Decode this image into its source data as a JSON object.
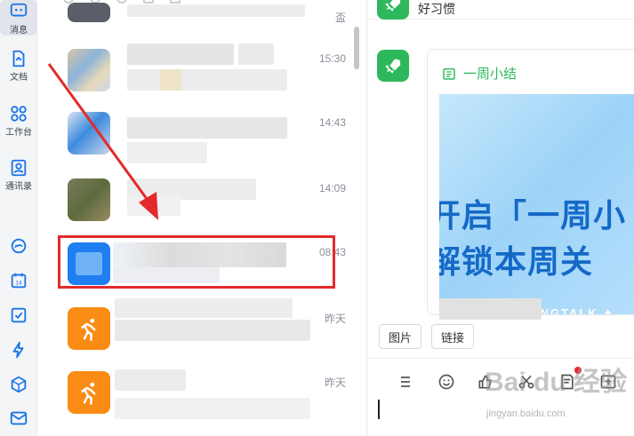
{
  "nav": {
    "items": [
      {
        "label": "消息",
        "icon": "chat-icon",
        "active": true
      },
      {
        "label": "文档",
        "icon": "document-icon",
        "active": false
      },
      {
        "label": "工作台",
        "icon": "grid-icon",
        "active": false
      },
      {
        "label": "通讯录",
        "icon": "contacts-icon",
        "active": false
      },
      {
        "label": "",
        "icon": "cloud-icon",
        "active": false
      },
      {
        "label": "",
        "icon": "calendar-icon",
        "active": false
      },
      {
        "label": "",
        "icon": "task-check-icon",
        "active": false
      },
      {
        "label": "",
        "icon": "lightning-icon",
        "active": false
      },
      {
        "label": "",
        "icon": "cube-icon",
        "active": false
      },
      {
        "label": "",
        "icon": "mail-icon",
        "active": false
      }
    ]
  },
  "conversations": [
    {
      "time": "",
      "avatar": "photo-collage",
      "partial_label": "盃"
    },
    {
      "time": "15:30",
      "avatar": "photo-collage"
    },
    {
      "time": "14:43",
      "avatar": "blue-collage"
    },
    {
      "time": "14:09",
      "avatar": "photo-dark"
    },
    {
      "time": "08:43",
      "avatar": "blue-app",
      "highlighted": true
    },
    {
      "time": "昨天",
      "avatar": "orange-runner"
    },
    {
      "time": "昨天",
      "avatar": "orange-runner"
    }
  ],
  "chat": {
    "title": "好习惯",
    "card": {
      "header": "一周小结",
      "banner_line1": "开启「一周小",
      "banner_line2": "解锁本周关",
      "banner_brand": "✦ DINGTALK ✦"
    },
    "chips": [
      {
        "label": "图片"
      },
      {
        "label": "链接"
      }
    ],
    "toolbar": [
      "list-icon",
      "emoji-icon",
      "thumbs-up-icon",
      "scissors-icon",
      "note-icon",
      "upload-icon"
    ]
  },
  "watermark": {
    "main": "Bai du 经验",
    "sub": "jingyan.baidu.com"
  },
  "colors": {
    "accent_green": "#2eb85c",
    "highlight_red": "#e32a2a",
    "banner_blue": "#1569c7",
    "orange": "#fa8c16"
  }
}
